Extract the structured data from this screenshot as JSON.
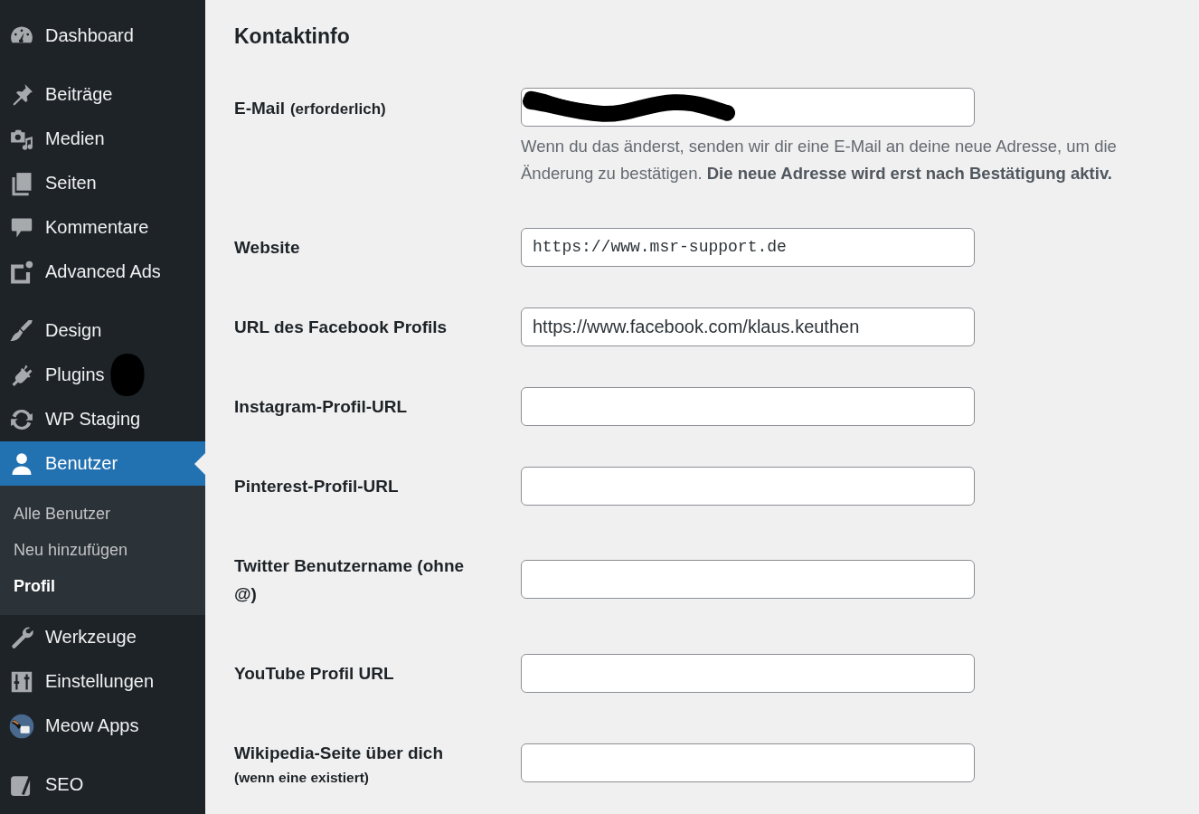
{
  "sidebar": {
    "groups": [
      {
        "items": [
          {
            "label": "Dashboard",
            "selected": false,
            "redacted": false
          }
        ]
      },
      {
        "items": [
          {
            "label": "Beiträge",
            "selected": false,
            "redacted": false
          },
          {
            "label": "Medien",
            "selected": false,
            "redacted": false
          },
          {
            "label": "Seiten",
            "selected": false,
            "redacted": false
          },
          {
            "label": "Kommentare",
            "selected": false,
            "redacted": false
          },
          {
            "label": "Advanced Ads",
            "selected": false,
            "redacted": false
          }
        ]
      },
      {
        "items": [
          {
            "label": "Design",
            "selected": false,
            "redacted": false
          },
          {
            "label": "Plugins",
            "selected": false,
            "redacted": true
          },
          {
            "label": "WP Staging",
            "selected": false,
            "redacted": false
          },
          {
            "label": "Benutzer",
            "selected": true,
            "redacted": false,
            "children": [
              {
                "label": "Alle Benutzer",
                "selected": false
              },
              {
                "label": "Neu hinzufügen",
                "selected": false
              },
              {
                "label": "Profil",
                "selected": true
              }
            ]
          },
          {
            "label": "Werkzeuge",
            "selected": false,
            "redacted": false
          },
          {
            "label": "Einstellungen",
            "selected": false,
            "redacted": false
          },
          {
            "label": "Meow Apps",
            "selected": false,
            "redacted": false
          }
        ]
      },
      {
        "items": [
          {
            "label": "SEO",
            "selected": false,
            "redacted": false
          }
        ]
      }
    ]
  },
  "profile_form": {
    "section_title": "Kontaktinfo",
    "fields": [
      {
        "label": "E-Mail",
        "note": "(erforderlich)",
        "kind": "text",
        "redacted": true,
        "description": "Wenn du das änderst, senden wir dir eine E-Mail an deine neue Adresse, um die Änderung zu bestätigen. **Die neue Adresse wird erst nach Bestätigung aktiv.**"
      },
      {
        "label": "Website",
        "kind": "code",
        "redacted": false,
        "value": "https://www.msr-support.de"
      },
      {
        "label": "URL des Facebook Profils",
        "kind": "text",
        "redacted": false,
        "value": "https://www.facebook.com/klaus.keuthen"
      },
      {
        "label": "Instagram-Profil-URL",
        "kind": "text",
        "redacted": false
      },
      {
        "label": "Pinterest-Profil-URL",
        "kind": "text",
        "redacted": false
      },
      {
        "label": "Twitter Benutzername (ohne @)",
        "kind": "text",
        "redacted": false
      },
      {
        "label": "YouTube Profil URL",
        "kind": "text",
        "redacted": false
      },
      {
        "label": "Wikipedia-Seite über dich",
        "caption": "(wenn eine existiert)",
        "kind": "text",
        "redacted": false
      }
    ]
  }
}
